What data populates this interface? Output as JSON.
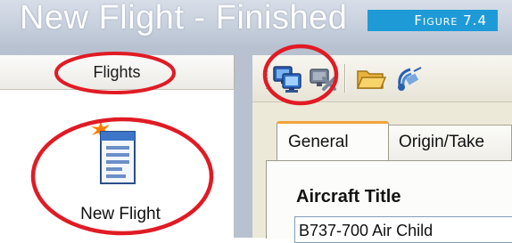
{
  "window": {
    "title": "New Flight - Finished"
  },
  "figure": {
    "label": "Figure 7.4"
  },
  "left_panel": {
    "header": "Flights",
    "items": [
      {
        "label": "New Flight",
        "icon": "new-flight-icon"
      }
    ]
  },
  "toolbar": {
    "buttons": [
      {
        "icon": "network-computers-icon"
      },
      {
        "icon": "disconnect-icon"
      },
      {
        "icon": "open-folder-icon"
      },
      {
        "icon": "satellite-icon"
      }
    ]
  },
  "tabs": [
    {
      "label": "General",
      "selected": true
    },
    {
      "label": "Origin/Take"
    }
  ],
  "general_tab": {
    "aircraft_title_label": "Aircraft Title",
    "aircraft_title_value": "B737-700 Air Child"
  },
  "colors": {
    "highlight_ellipse": "#e01b24",
    "figure_label_bg": "#1e9bd7",
    "tab_accent": "#f3a33a"
  }
}
